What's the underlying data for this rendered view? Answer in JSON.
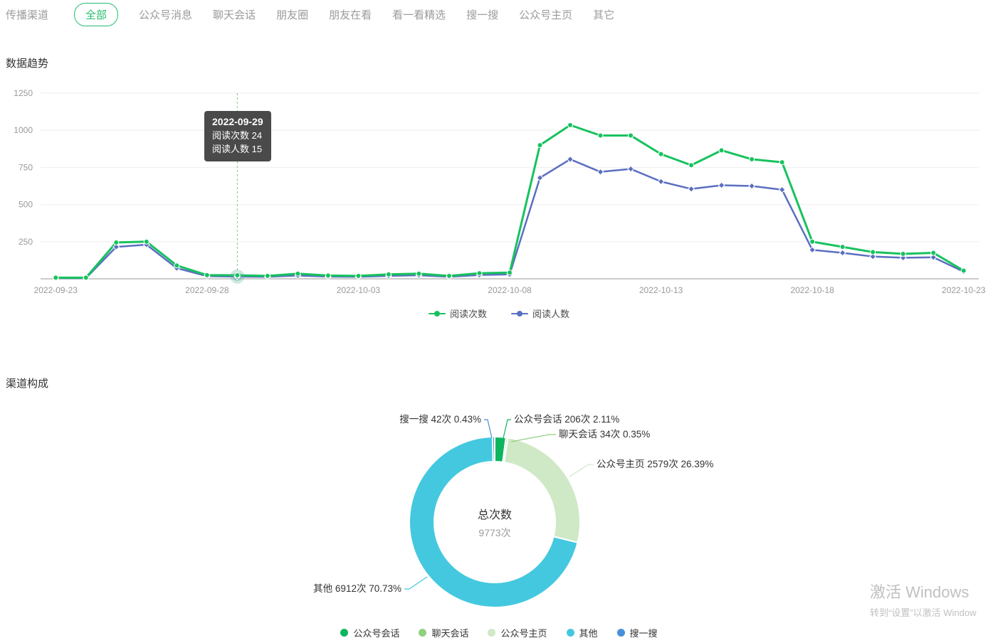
{
  "nav": {
    "label": "传播渠道",
    "tabs": [
      {
        "label": "全部",
        "active": true
      },
      {
        "label": "公众号消息",
        "active": false
      },
      {
        "label": "聊天会话",
        "active": false
      },
      {
        "label": "朋友圈",
        "active": false
      },
      {
        "label": "朋友在看",
        "active": false
      },
      {
        "label": "看一看精选",
        "active": false
      },
      {
        "label": "搜一搜",
        "active": false
      },
      {
        "label": "公众号主页",
        "active": false
      },
      {
        "label": "其它",
        "active": false
      }
    ]
  },
  "sections": {
    "trend_title": "数据趋势",
    "channel_title": "渠道构成"
  },
  "tooltip": {
    "title": "2022-09-29",
    "rows": [
      {
        "label": "阅读次数",
        "value": "24"
      },
      {
        "label": "阅读人数",
        "value": "15"
      }
    ]
  },
  "chart_data": [
    {
      "type": "line",
      "title": "数据趋势",
      "x": [
        "2022-09-23",
        "2022-09-24",
        "2022-09-25",
        "2022-09-26",
        "2022-09-27",
        "2022-09-28",
        "2022-09-29",
        "2022-09-30",
        "2022-10-01",
        "2022-10-02",
        "2022-10-03",
        "2022-10-04",
        "2022-10-05",
        "2022-10-06",
        "2022-10-07",
        "2022-10-08",
        "2022-10-09",
        "2022-10-10",
        "2022-10-11",
        "2022-10-12",
        "2022-10-13",
        "2022-10-14",
        "2022-10-15",
        "2022-10-16",
        "2022-10-17",
        "2022-10-18",
        "2022-10-19",
        "2022-10-20",
        "2022-10-21",
        "2022-10-22",
        "2022-10-23"
      ],
      "series": [
        {
          "name": "阅读次数",
          "color": "#17c25e",
          "values": [
            8,
            8,
            245,
            250,
            90,
            25,
            24,
            20,
            35,
            22,
            20,
            30,
            35,
            20,
            38,
            42,
            900,
            1035,
            965,
            965,
            840,
            765,
            865,
            805,
            785,
            250,
            215,
            180,
            168,
            175,
            55
          ]
        },
        {
          "name": "阅读人数",
          "color": "#5b6fc0",
          "values": [
            5,
            5,
            215,
            230,
            72,
            18,
            15,
            14,
            22,
            15,
            14,
            20,
            24,
            14,
            26,
            30,
            680,
            805,
            720,
            740,
            655,
            605,
            630,
            625,
            600,
            195,
            175,
            150,
            142,
            145,
            48
          ]
        }
      ],
      "ylim": [
        0,
        1250
      ],
      "yticks": [
        250,
        500,
        750,
        1000,
        1250
      ],
      "xticks_shown": [
        "2022-09-23",
        "2022-09-28",
        "2022-10-03",
        "2022-10-08",
        "2022-10-13",
        "2022-10-18",
        "2022-10-23"
      ],
      "highlight_x": "2022-09-29",
      "grid": true,
      "legend_position": "bottom"
    },
    {
      "type": "pie",
      "title": "渠道构成",
      "center_label": "总次数",
      "center_value": "9773次",
      "total": 9773,
      "unit": "次",
      "slices": [
        {
          "name": "公众号会话",
          "count": 206,
          "percent": 2.11,
          "label": "公众号会话 206次 2.11%",
          "color": "#0db55f"
        },
        {
          "name": "聊天会话",
          "count": 34,
          "percent": 0.35,
          "label": "聊天会话 34次 0.35%",
          "color": "#8fd07f"
        },
        {
          "name": "公众号主页",
          "count": 2579,
          "percent": 26.39,
          "label": "公众号主页 2579次 26.39%",
          "color": "#cfe9c7"
        },
        {
          "name": "其他",
          "count": 6912,
          "percent": 70.73,
          "label": "其他 6912次 70.73%",
          "color": "#44c8df"
        },
        {
          "name": "搜一搜",
          "count": 42,
          "percent": 0.43,
          "label": "搜一搜 42次 0.43%",
          "color": "#478fd9"
        }
      ]
    }
  ],
  "colors": {
    "accent_green": "#26bd6e",
    "line_read_count": "#17c25e",
    "line_read_users": "#5b6fc0",
    "grid": "#eeeeee",
    "axis": "#cccccc",
    "tick_text": "#999999"
  },
  "watermark": {
    "line1": "激活 Windows",
    "line2": "转到“设置”以激活 Window"
  }
}
